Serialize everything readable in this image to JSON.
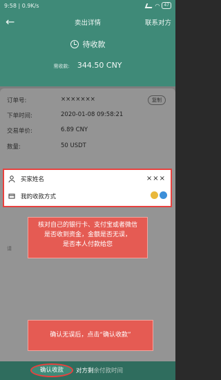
{
  "status_bar": {
    "time": "9:58",
    "speed": "0.9K/s",
    "battery": "47"
  },
  "nav": {
    "back_icon": "back-arrow-icon",
    "title": "卖出详情",
    "contact": "联系对方"
  },
  "order_status": {
    "icon": "clock-icon",
    "text": "待收款"
  },
  "amount": {
    "label": "需收款:",
    "value": "344.50 CNY"
  },
  "details": {
    "rows": [
      {
        "key": "订单号:",
        "value": "×××××××",
        "action": "复制"
      },
      {
        "key": "下单时间:",
        "value": "2020-01-08 09:58:21"
      },
      {
        "key": "交易单价:",
        "value": "6.89 CNY"
      },
      {
        "key": "数量:",
        "value": "50 USDT"
      }
    ]
  },
  "buyer": {
    "name_label": "买家姓名",
    "name_value": "×××",
    "payment_label": "我的收款方式"
  },
  "hint_cut": "请",
  "tips": {
    "verify": [
      "核对自己的银行卡、支付宝或者微信",
      "是否收到资金，金额是否无误，",
      "是否本人付款给您"
    ],
    "confirm": "确认无误后，点击“确认收款”"
  },
  "bottom": {
    "confirm_button": "确认收款",
    "countdown_prefix": "对方剩",
    "countdown_rest": "余付款时间"
  },
  "colors": {
    "brand_green": "#3f8a78",
    "highlight_red": "#e8413e",
    "tip_red": "#e55b53"
  }
}
